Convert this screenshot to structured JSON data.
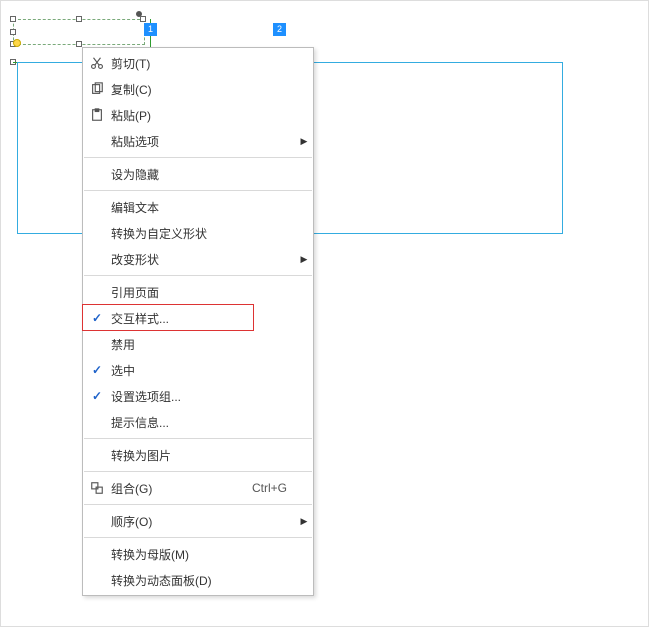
{
  "flags": [
    "1",
    "2"
  ],
  "menu": [
    {
      "icon": "cut",
      "label": "剪切(T)"
    },
    {
      "icon": "copy",
      "label": "复制(C)"
    },
    {
      "icon": "paste",
      "label": "粘贴(P)"
    },
    {
      "label": "粘贴选项",
      "sub": true
    },
    {
      "sep": true
    },
    {
      "label": "设为隐藏"
    },
    {
      "sep": true
    },
    {
      "label": "编辑文本"
    },
    {
      "label": "转换为自定义形状"
    },
    {
      "label": "改变形状",
      "sub": true
    },
    {
      "sep": true
    },
    {
      "label": "引用页面"
    },
    {
      "check": true,
      "label": "交互样式...",
      "highlight": true
    },
    {
      "label": "禁用"
    },
    {
      "check": true,
      "label": "选中"
    },
    {
      "check": true,
      "label": "设置选项组..."
    },
    {
      "label": "提示信息..."
    },
    {
      "sep": true
    },
    {
      "label": "转换为图片"
    },
    {
      "sep": true
    },
    {
      "icon": "group",
      "label": "组合(G)",
      "accel": "Ctrl+G"
    },
    {
      "sep": true
    },
    {
      "label": "顺序(O)",
      "sub": true
    },
    {
      "sep": true
    },
    {
      "label": "转换为母版(M)"
    },
    {
      "label": "转换为动态面板(D)"
    }
  ]
}
